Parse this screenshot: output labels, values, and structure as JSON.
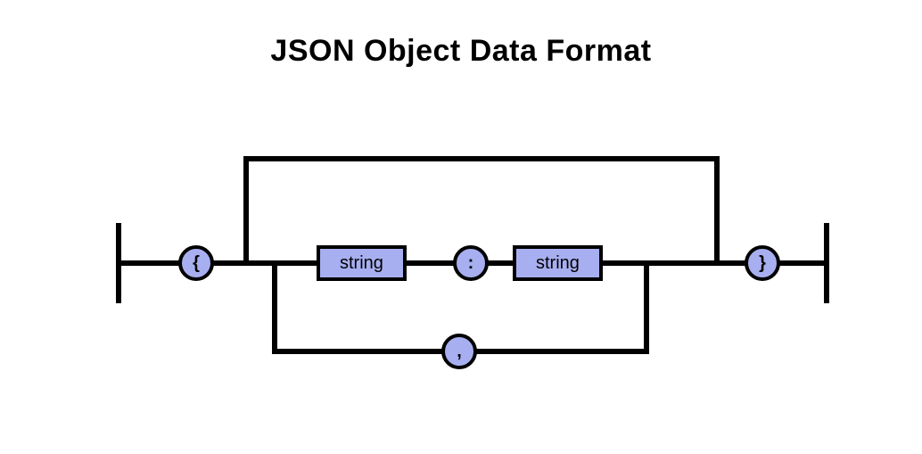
{
  "title": "JSON Object Data Format",
  "tokens": {
    "open_brace": "{",
    "close_brace": "}",
    "colon": ":",
    "comma": ",",
    "string_key": "string",
    "string_value": "string"
  },
  "colors": {
    "fill": "#a8aff0",
    "stroke": "#000000",
    "background": "#ffffff"
  }
}
